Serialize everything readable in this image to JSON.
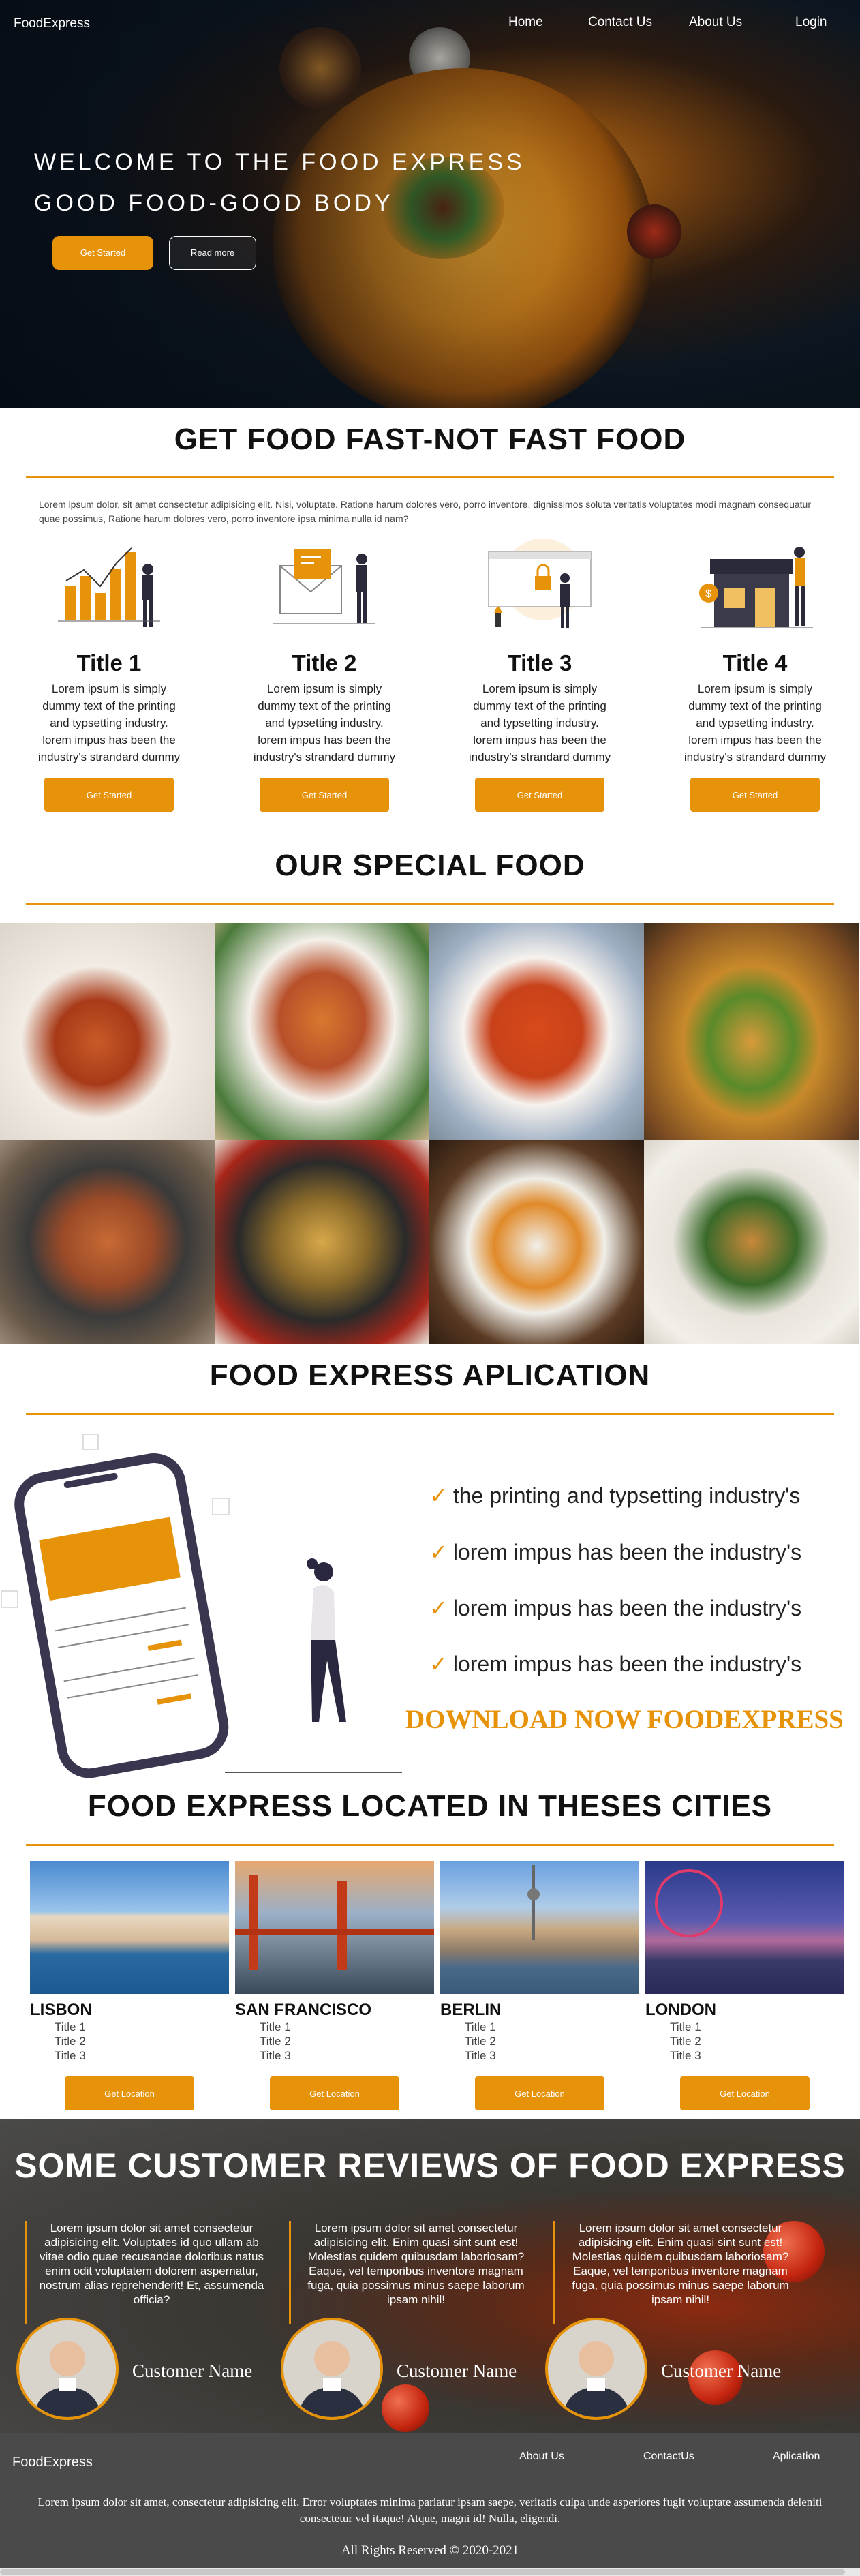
{
  "nav": {
    "brand": "FoodExpress",
    "links": [
      "Home",
      "Contact Us",
      "About Us",
      "Login"
    ]
  },
  "hero": {
    "line1": "WELCOME TO THE FOOD EXPRESS",
    "line2": "GOOD FOOD-GOOD BODY",
    "btn_primary": "Get Started",
    "btn_secondary": "Read more"
  },
  "section1": {
    "title": "GET FOOD FAST-NOT FAST FOOD",
    "text": "Lorem ipsum dolor, sit amet consectetur adipisicing elit. Nisi, voluptate. Ratione harum dolores vero, porro inventore, dignissimos soluta veritatis voluptates modi magnam consequatur quae possimus, Ratione harum dolores vero, porro inventore ipsa minima nulla id nam?",
    "features": [
      {
        "title": "Title 1",
        "text": "Lorem ipsum is simply dummy text of the printing and typsetting industry. lorem impus has been the industry's strandard dummy",
        "button": "Get Started",
        "icon": "bar-chart-person-icon"
      },
      {
        "title": "Title 2",
        "text": "Lorem ipsum is simply dummy text of the printing and typsetting industry. lorem impus has been the industry's strandard dummy",
        "button": "Get Started",
        "icon": "envelope-person-icon"
      },
      {
        "title": "Title 3",
        "text": "Lorem ipsum is simply dummy text of the printing and typsetting industry. lorem impus has been the industry's strandard dummy",
        "button": "Get Started",
        "icon": "lock-screen-person-icon"
      },
      {
        "title": "Title 4",
        "text": "Lorem ipsum is simply dummy text of the printing and typsetting industry. lorem impus has been the industry's strandard dummy",
        "button": "Get Started",
        "icon": "shop-person-icon"
      }
    ]
  },
  "section2": {
    "title": "OUR SPECIAL FOOD"
  },
  "section3": {
    "title": "FOOD EXPRESS APLICATION",
    "checks": [
      "the printing and typsetting industry's",
      "lorem impus has been the industry's",
      "lorem impus has been the industry's",
      "lorem impus has been the industry's"
    ],
    "download": "DOWNLOAD NOW FOODEXPRESS"
  },
  "section4": {
    "title": "FOOD EXPRESS LOCATED IN THESES CITIES",
    "cities": [
      {
        "name": "LISBON",
        "items": [
          "Title 1",
          "Title 2",
          "Title 3"
        ],
        "button": "Get Location"
      },
      {
        "name": "SAN FRANCISCO",
        "items": [
          "Title 1",
          "Title 2",
          "Title 3"
        ],
        "button": "Get Location"
      },
      {
        "name": "BERLIN",
        "items": [
          "Title 1",
          "Title 2",
          "Title 3"
        ],
        "button": "Get Location"
      },
      {
        "name": "LONDON",
        "items": [
          "Title 1",
          "Title 2",
          "Title 3"
        ],
        "button": "Get Location"
      }
    ]
  },
  "reviews": {
    "title": "SOME CUSTOMER REVIEWS OF FOOD EXPRESS",
    "items": [
      {
        "text": "Lorem ipsum dolor sit amet consectetur adipisicing elit. Voluptates id quo ullam ab vitae odio quae recusandae doloribus natus enim odit voluptatem dolorem aspernatur, nostrum alias reprehenderit! Et, assumenda officia?",
        "name": "Customer Name"
      },
      {
        "text": "Lorem ipsum dolor sit amet consectetur adipisicing elit. Enim quasi sint sunt est! Molestias quidem quibusdam laboriosam? Eaque, vel temporibus inventore magnam fuga, quia possimus minus saepe laborum ipsam nihil!",
        "name": "Customer Name"
      },
      {
        "text": "Lorem ipsum dolor sit amet consectetur adipisicing elit. Enim quasi sint sunt est! Molestias quidem quibusdam laboriosam? Eaque, vel temporibus inventore magnam fuga, quia possimus minus saepe laborum ipsam nihil!",
        "name": "Customer Name"
      }
    ]
  },
  "footer": {
    "brand": "FoodExpress",
    "links": [
      "About Us",
      "ContactUs",
      "Aplication"
    ],
    "text": "Lorem ipsum dolor sit amet, consectetur adipisicing elit. Error voluptates minima pariatur ipsam saepe, veritatis culpa unde asperiores fugit voluptate assumenda deleniti consectetur vel itaque! Atque, magni id! Nulla, eligendi.",
    "copyright": "All Rights Reserved © 2020-2021"
  },
  "colors": {
    "accent": "#e6930a",
    "footer_bg": "#4a4a4a",
    "hero_bg": "#0c1620"
  }
}
